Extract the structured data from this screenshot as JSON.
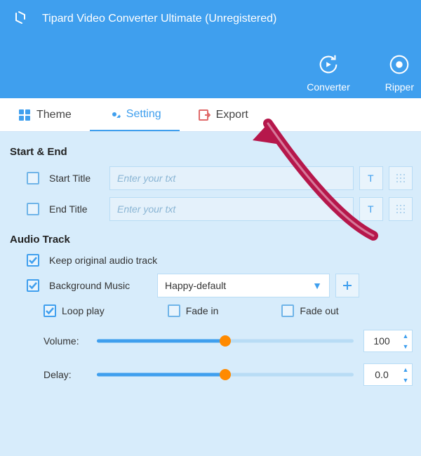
{
  "header": {
    "title": "Tipard Video Converter Ultimate (Unregistered)",
    "nav": {
      "converter": "Converter",
      "ripper": "Ripper"
    }
  },
  "tabs": {
    "theme": "Theme",
    "setting": "Setting",
    "export": "Export"
  },
  "sections": {
    "start_end": {
      "title": "Start & End",
      "start_label": "Start Title",
      "end_label": "End Title",
      "placeholder": "Enter your txt"
    },
    "audio": {
      "title": "Audio Track",
      "keep": "Keep original audio track",
      "bgm": "Background Music",
      "bgm_value": "Happy-default",
      "loop": "Loop play",
      "fade_in": "Fade in",
      "fade_out": "Fade out",
      "volume_label": "Volume:",
      "volume_value": "100",
      "volume_pct": 50,
      "delay_label": "Delay:",
      "delay_value": "0.0",
      "delay_pct": 50
    }
  }
}
